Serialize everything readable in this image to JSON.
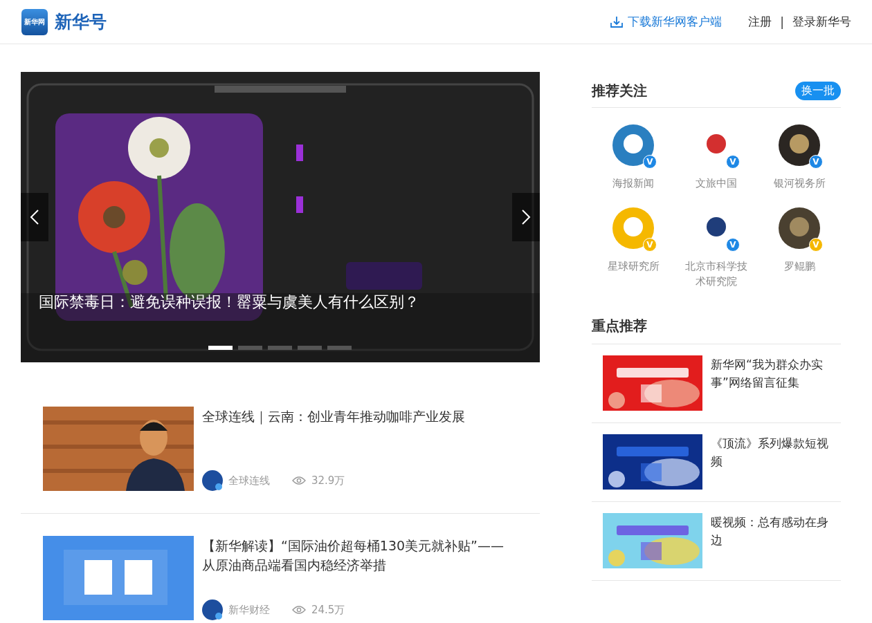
{
  "header": {
    "logo_badge": "新华网",
    "brand": "新华号",
    "download": "下载新华网客户端",
    "register": "注册",
    "separator": "|",
    "login": "登录新华号"
  },
  "carousel": {
    "caption": "国际禁毒日：避免误种误报！罂粟与虞美人有什么区别？",
    "dots": [
      {
        "selected": true
      },
      {
        "selected": false
      },
      {
        "selected": false
      },
      {
        "selected": false
      },
      {
        "selected": false
      }
    ]
  },
  "news": [
    {
      "title": "全球连线｜云南：创业青年推动咖啡产业发展",
      "source": "全球连线",
      "views": "32.9万"
    },
    {
      "title": "【新华解读】“国际油价超每桶130美元就补贴”——从原油商品端看国内稳经济举措",
      "source": "新华财经",
      "views": "24.5万"
    }
  ],
  "recommend": {
    "title": "推荐关注",
    "refresh": "换一批",
    "accounts": [
      {
        "name": "海报新闻",
        "badge": "V",
        "color": "#1e88e5"
      },
      {
        "name": "文旅中国",
        "badge": "V",
        "color": "#1e88e5"
      },
      {
        "name": "银河视务所",
        "badge": "V",
        "color": "#1e88e5"
      },
      {
        "name": "星球研究所",
        "badge": "V",
        "color": "#f5b800"
      },
      {
        "name": "北京市科学技术研究院",
        "badge": "V",
        "color": "#1e88e5"
      },
      {
        "name": "罗鲲鹏",
        "badge": "V",
        "color": "#f5b800"
      }
    ]
  },
  "featured": {
    "title": "重点推荐",
    "items": [
      {
        "title": "新华网“我为群众办实事”网络留言征集"
      },
      {
        "title": "《顶流》系列爆款短视频"
      },
      {
        "title": "暖视频：总有感动在身边"
      }
    ]
  }
}
